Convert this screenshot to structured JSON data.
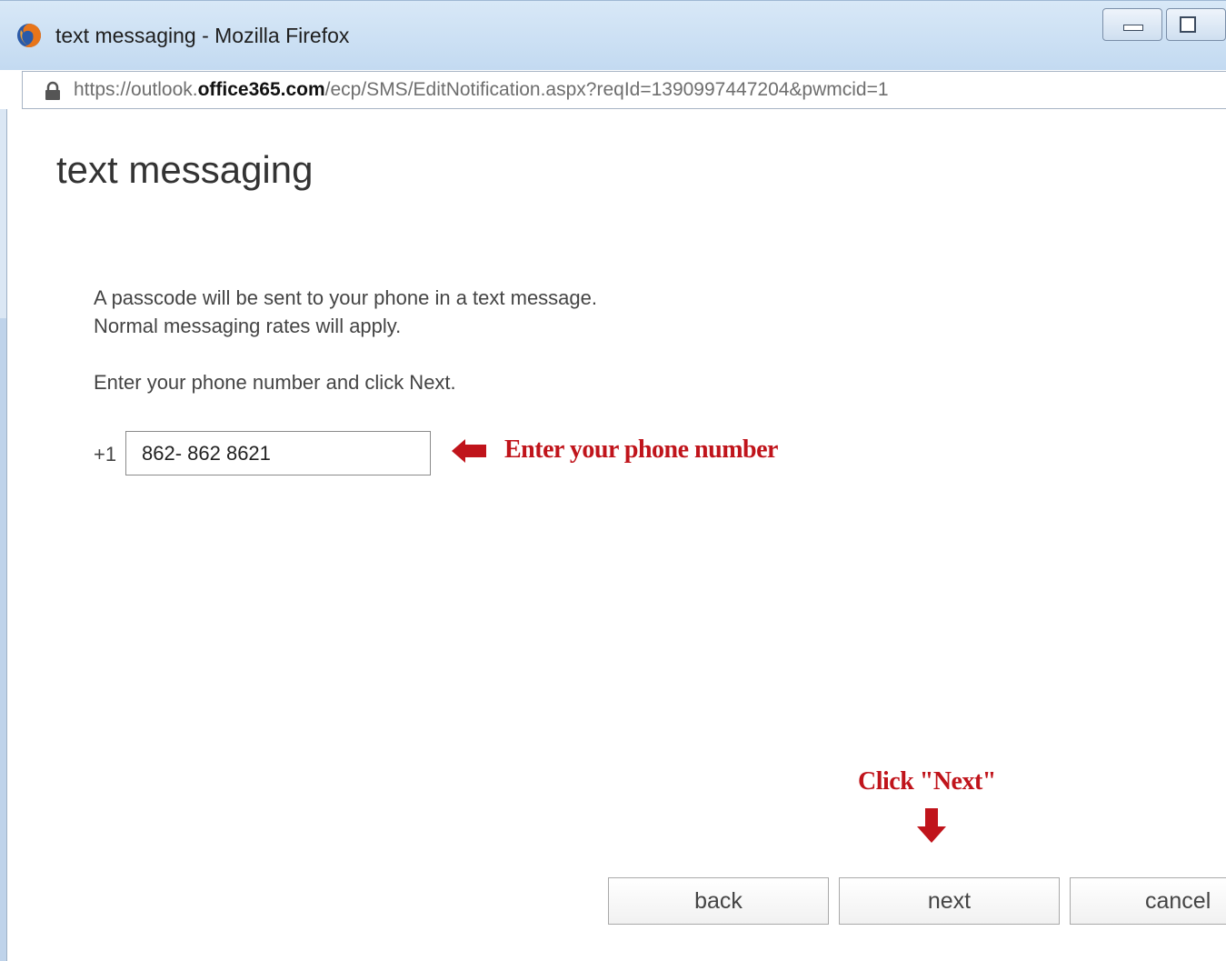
{
  "window": {
    "title": "text messaging - Mozilla Firefox"
  },
  "address_bar": {
    "url_prefix": "https://outlook.",
    "url_domain": "office365.com",
    "url_path": "/ecp/SMS/EditNotification.aspx?reqId=1390997447204&pwmcid=1"
  },
  "page": {
    "title": "text messaging",
    "info_line_1": "A passcode will be sent to your phone in a text message.",
    "info_line_2": "Normal messaging rates will apply.",
    "instruction": "Enter your phone number and click Next.",
    "country_code": "+1",
    "phone_value": "862- 862 8621"
  },
  "annotations": {
    "enter_phone": "Enter your phone number",
    "click_next": "Click \"Next\"",
    "color": "#c0141b"
  },
  "buttons": {
    "back": "back",
    "next": "next",
    "cancel": "cancel"
  },
  "icons": {
    "browser": "firefox-icon",
    "secure": "lock-icon",
    "minimize": "minimize-icon",
    "maximize": "maximize-icon",
    "annotation_left": "arrow-left-icon",
    "annotation_down": "arrow-down-icon"
  }
}
